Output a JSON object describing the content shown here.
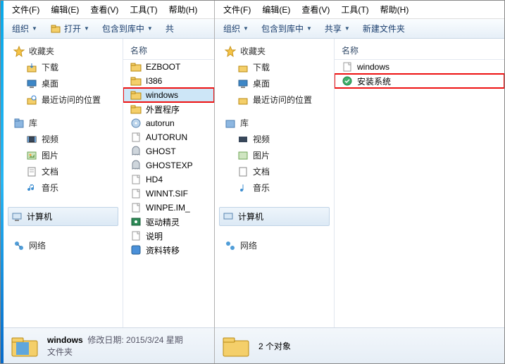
{
  "menus": {
    "file": "文件(F)",
    "edit": "编辑(E)",
    "view": "查看(V)",
    "tools": "工具(T)",
    "help": "帮助(H)"
  },
  "toolbar": {
    "organize": "组织",
    "open": "打开",
    "include": "包含到库中",
    "share": "共享",
    "shareShort": "共",
    "newFolder": "新建文件夹"
  },
  "nav": {
    "favorites": "收藏夹",
    "downloads": "下载",
    "desktop": "桌面",
    "recent": "最近访问的位置",
    "libraries": "库",
    "videos": "视频",
    "pictures": "图片",
    "documents": "文档",
    "music": "音乐",
    "computer": "计算机",
    "network": "网络"
  },
  "headers": {
    "name": "名称"
  },
  "left": {
    "files": [
      {
        "name": "EZBOOT",
        "icon": "folder"
      },
      {
        "name": "I386",
        "icon": "folder"
      },
      {
        "name": "windows",
        "icon": "folder",
        "sel": true,
        "hl": true
      },
      {
        "name": "外置程序",
        "icon": "folder"
      },
      {
        "name": "autorun",
        "icon": "cd"
      },
      {
        "name": "AUTORUN",
        "icon": "file"
      },
      {
        "name": "GHOST",
        "icon": "ghost"
      },
      {
        "name": "GHOSTEXP",
        "icon": "ghost"
      },
      {
        "name": "HD4",
        "icon": "file"
      },
      {
        "name": "WINNT.SIF",
        "icon": "file"
      },
      {
        "name": "WINPE.IM_",
        "icon": "file"
      },
      {
        "name": "驱动精灵",
        "icon": "drv"
      },
      {
        "name": "说明",
        "icon": "file"
      },
      {
        "name": "资料转移",
        "icon": "app"
      }
    ],
    "status": {
      "title": "windows",
      "mod_label": "修改日期:",
      "mod": "2015/3/24 星期",
      "type": "文件夹"
    }
  },
  "right": {
    "files": [
      {
        "name": "windows",
        "icon": "file"
      },
      {
        "name": "安装系统",
        "icon": "inst",
        "hl": true
      }
    ],
    "status": {
      "count": "2 个对象"
    }
  }
}
